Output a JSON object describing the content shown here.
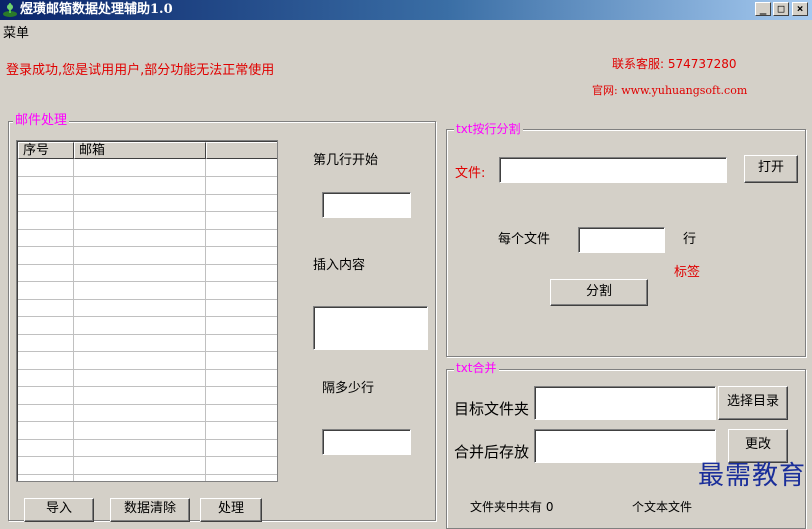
{
  "window": {
    "title": "煜璜邮箱数据处理辅助1.0",
    "buttons": {
      "minimize": "_",
      "maximize": "□",
      "close": "×"
    }
  },
  "menu": {
    "label": "菜单"
  },
  "status": {
    "login_message": "登录成功,您是试用用户,部分功能无法正常使用",
    "support": "联系客服: 574737280",
    "website": "官网: www.yuhuangsoft.com"
  },
  "mail_group": {
    "title": "邮件处理",
    "columns": [
      "序号",
      "邮箱",
      ""
    ],
    "start_row_label": "第几行开始",
    "start_row_value": "",
    "insert_label": "插入内容",
    "insert_value": "",
    "gap_label": "隔多少行",
    "gap_value": "",
    "bottom_buttons": [
      "导入",
      "数据清除",
      "处理"
    ]
  },
  "split_group": {
    "title": "txt按行分割",
    "file_label": "文件:",
    "file_value": "",
    "open_button": "打开",
    "per_file_label": "每个文件",
    "per_file_value": "",
    "row_unit": "行",
    "tag_label": "标签",
    "split_button": "分割"
  },
  "merge_group": {
    "title": "txt合并",
    "target_folder_label": "目标文件夹",
    "target_folder_value": "",
    "select_dir_button": "选择目录",
    "save_label": "合并后存放",
    "save_value": "",
    "change_button": "更改",
    "count_label": "文件夹中共有 0",
    "file_unit": "个文本文件"
  },
  "watermark": "最需教育",
  "colors": {
    "title_start": "#0a246a",
    "title_end": "#a6caf0",
    "status_red": "#e00000",
    "group_magenta": "#ff00ff"
  }
}
